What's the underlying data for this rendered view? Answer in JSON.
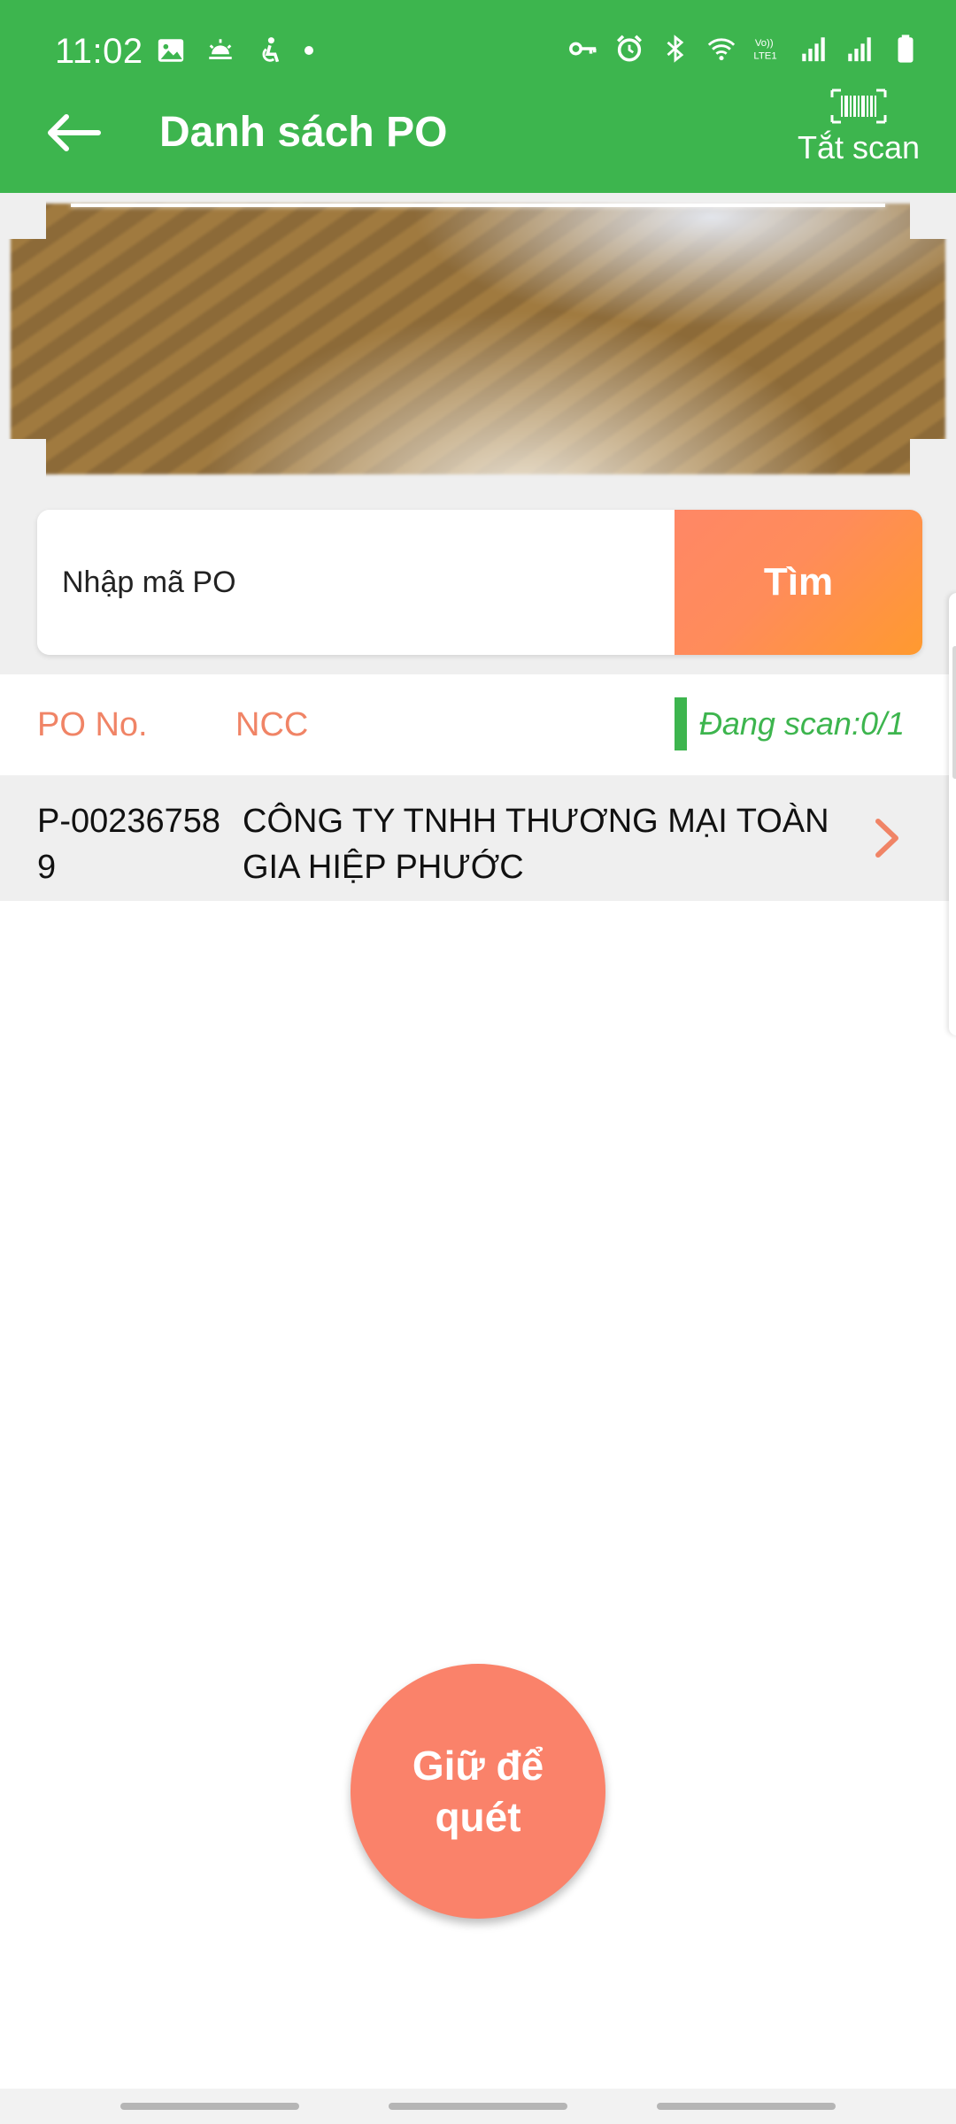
{
  "status_bar": {
    "time": "11:02",
    "left_icons": [
      "gallery-icon",
      "weather-icon",
      "accessibility-icon",
      "notification-dot"
    ],
    "right_icons": [
      "vpn-key-icon",
      "alarm-icon",
      "bluetooth-icon",
      "wifi-icon",
      "volte-icon",
      "signal-icon",
      "signal-icon",
      "battery-icon"
    ],
    "volte_label": "Vo))\nLTE1"
  },
  "app_bar": {
    "title": "Danh sách PO",
    "scan_toggle_label": "Tắt scan",
    "color": "#3db54e"
  },
  "search": {
    "placeholder": "Nhập mã PO",
    "button_label": "Tìm"
  },
  "list_header": {
    "po_label": "PO No.",
    "ncc_label": "NCC",
    "scan_status": "Đang scan:0/1"
  },
  "rows": [
    {
      "po_no": "P-002367589",
      "ncc": "CÔNG TY TNHH THƯƠNG MẠI TOÀN GIA HIỆP PHƯỚC"
    }
  ],
  "hold_button": {
    "label": "Giữ để quét"
  },
  "colors": {
    "primary_green": "#3db54e",
    "accent_orange": "#fa826a",
    "label_orange": "#f08466"
  }
}
